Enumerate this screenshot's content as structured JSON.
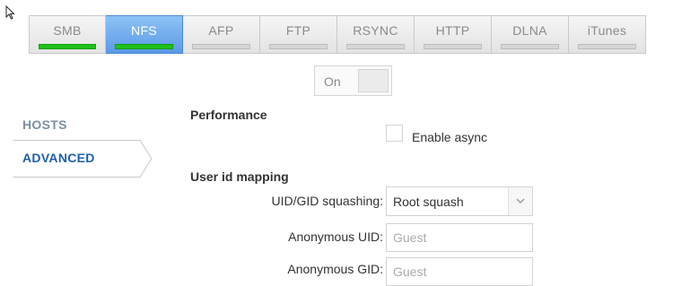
{
  "protocol_tabs": [
    {
      "label": "SMB",
      "enabled": true,
      "active": false
    },
    {
      "label": "NFS",
      "enabled": true,
      "active": true
    },
    {
      "label": "AFP",
      "enabled": false,
      "active": false
    },
    {
      "label": "FTP",
      "enabled": false,
      "active": false
    },
    {
      "label": "RSYNC",
      "enabled": false,
      "active": false
    },
    {
      "label": "HTTP",
      "enabled": false,
      "active": false
    },
    {
      "label": "DLNA",
      "enabled": false,
      "active": false
    },
    {
      "label": "iTunes",
      "enabled": false,
      "active": false
    }
  ],
  "service_toggle": {
    "label": "On"
  },
  "sidebar": {
    "items": [
      {
        "label": "HOSTS"
      },
      {
        "label": "ADVANCED",
        "selected": true
      }
    ]
  },
  "performance": {
    "title": "Performance",
    "async_label": "Enable async",
    "async_checked": false
  },
  "user_id_mapping": {
    "title": "User id mapping",
    "squashing_label": "UID/GID squashing:",
    "squashing_value": "Root squash",
    "anon_uid_label": "Anonymous UID:",
    "anon_uid_placeholder": "Guest",
    "anon_gid_label": "Anonymous GID:",
    "anon_gid_placeholder": "Guest"
  },
  "colors": {
    "active_tab": "#5a9ae6",
    "status_on": "#21c01b",
    "status_off": "#d6d6d6",
    "selected_sidebar_text": "#1f5fa8"
  },
  "icons": {
    "cursor": "mouse-pointer-icon",
    "select": "chevron-down-icon"
  }
}
